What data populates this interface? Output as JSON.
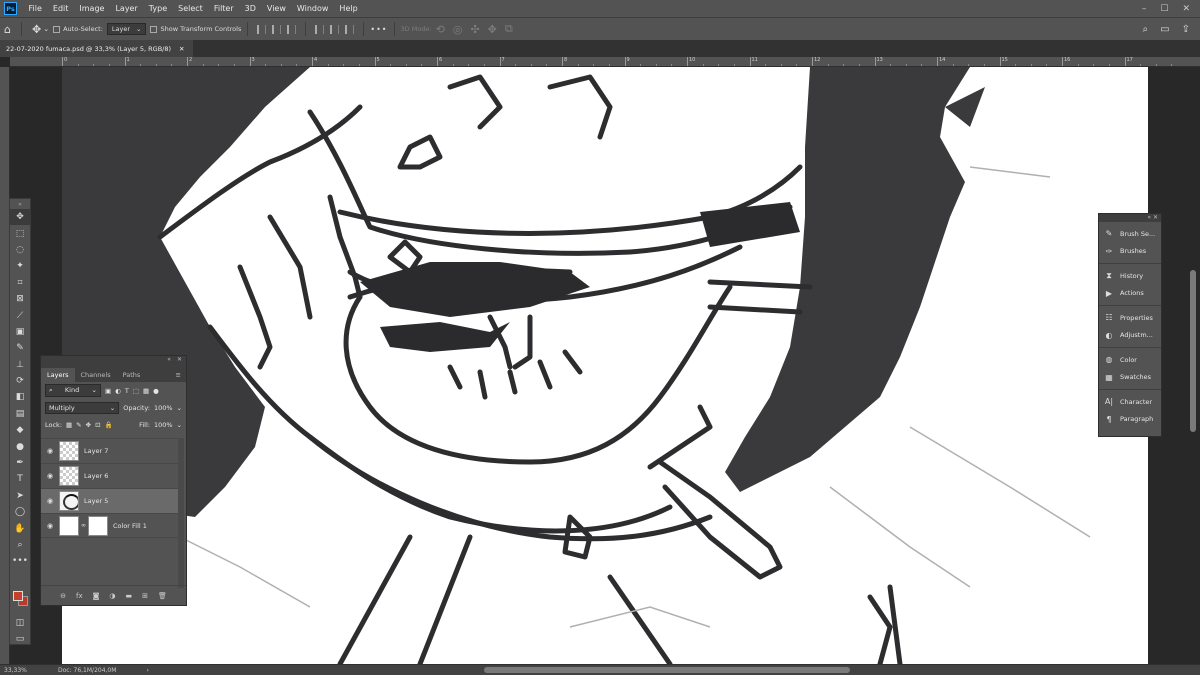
{
  "app": {
    "logo": "Ps"
  },
  "menu": [
    "File",
    "Edit",
    "Image",
    "Layer",
    "Type",
    "Select",
    "Filter",
    "3D",
    "View",
    "Window",
    "Help"
  ],
  "window_controls": [
    "–",
    "☐",
    "✕"
  ],
  "options_bar": {
    "auto_select_label": "Auto-Select:",
    "auto_select_value": "Layer",
    "transform_label": "Show Transform Controls",
    "more": "•••",
    "mode_3d": "3D Mode:"
  },
  "document_tab": {
    "title": "22-07-2020 fumaca.psd @ 33,3% (Layer 5, RGB/8)",
    "close": "✕"
  },
  "ruler_labels": [
    "0",
    "1",
    "2",
    "3",
    "4",
    "5",
    "6",
    "7",
    "8",
    "9",
    "10",
    "11",
    "12",
    "13",
    "14",
    "15",
    "16",
    "17"
  ],
  "layers_panel": {
    "tabs": [
      "Layers",
      "Channels",
      "Paths"
    ],
    "filter_kind": "Kind",
    "blend_mode": "Multiply",
    "opacity_label": "Opacity:",
    "opacity_value": "100%",
    "lock_label": "Lock:",
    "fill_label": "Fill:",
    "fill_value": "100%",
    "layers": [
      {
        "name": "Layer 7",
        "selected": false,
        "thumb": "transparent"
      },
      {
        "name": "Layer 6",
        "selected": false,
        "thumb": "transparent"
      },
      {
        "name": "Layer 5",
        "selected": true,
        "thumb": "artwork"
      },
      {
        "name": "Color Fill 1",
        "selected": false,
        "thumb": "fill"
      }
    ]
  },
  "right_panels": [
    [
      "Brush Se...",
      "Brushes"
    ],
    [
      "History",
      "Actions"
    ],
    [
      "Properties",
      "Adjustm..."
    ],
    [
      "Color",
      "Swatches"
    ],
    [
      "Character",
      "Paragraph"
    ]
  ],
  "colors": {
    "foreground": "#c4422a",
    "background": "#bb3b2b",
    "ui_dark": "#535353",
    "canvas_bg": "#282828"
  },
  "status": {
    "zoom": "33,33%",
    "doc": "Doc: 76,1M/204,0M",
    "arrow": "›"
  }
}
